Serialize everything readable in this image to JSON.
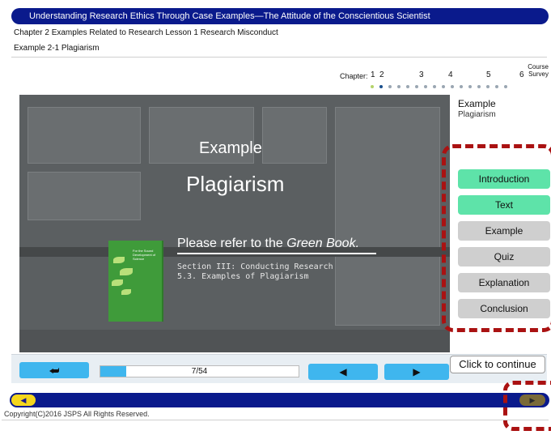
{
  "header": {
    "title": "Understanding Research Ethics Through Case Examples—The Attitude of the Conscientious Scientist",
    "chapter_line": "Chapter 2 Examples Related to Research Lesson 1 Research Misconduct",
    "example_line": "Example 2-1 Plagiarism"
  },
  "chapter_nav": {
    "label": "Chapter:",
    "numbers": [
      "1",
      "2",
      "3",
      "4",
      "5",
      "6"
    ],
    "course_survey": "Course Survey",
    "dots_total": 16,
    "active_dot": 1,
    "colors": {
      "visited": "#b4d36a",
      "current": "#1a4f8c",
      "default": "#9aa6b2"
    }
  },
  "slide": {
    "heading": "Example",
    "title": "Plagiarism",
    "refer_prefix": "Please refer to the ",
    "refer_italic": "Green Book.",
    "section_line_1": "Section III: Conducting Research",
    "section_line_2": "5.3. Examples of Plagiarism",
    "book": {
      "cover_text": "For the Sound Development of Science"
    }
  },
  "side_panel": {
    "label_title": "Example",
    "label_sub": "Plagiarism",
    "menu": [
      {
        "label": "Introduction",
        "active": true
      },
      {
        "label": "Text",
        "active": true
      },
      {
        "label": "Example",
        "active": false
      },
      {
        "label": "Quiz",
        "active": false
      },
      {
        "label": "Explanation",
        "active": false
      },
      {
        "label": "Conclusion",
        "active": false
      }
    ]
  },
  "controls": {
    "back_icon": "return-arrow-icon",
    "back_glyph": "⮨",
    "progress_text": "7/54",
    "progress_value": 0.13,
    "prev_glyph": "◀",
    "next_glyph": "▶",
    "tooltip": "Click to continue"
  },
  "bottom_nav": {
    "left_glyph": "◀",
    "right_glyph": "▶"
  },
  "footer": {
    "copyright": "Copyright(C)2016 JSPS All Rights Reserved."
  }
}
